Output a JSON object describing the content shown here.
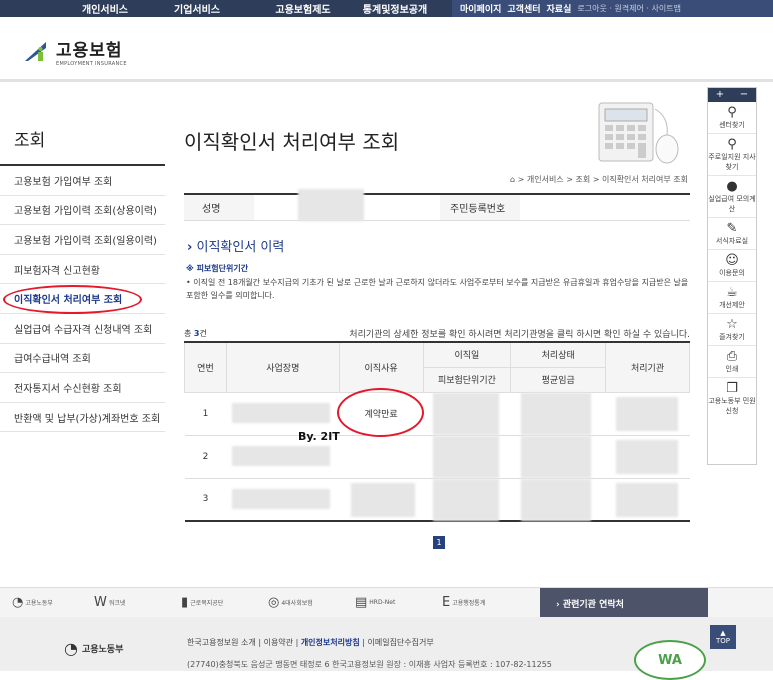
{
  "topnav": {
    "menu1": "개인서비스",
    "menu2": "기업서비스",
    "menu3": "고용보험제도",
    "menu4": "통계및정보공개",
    "mypage": "마이페이지",
    "center": "고객센터",
    "data": "자료실",
    "util": "로그아웃 · 원격제어 · 사이트맵"
  },
  "logo": {
    "name": "고용보험",
    "sub": "EMPLOYMENT INSURANCE"
  },
  "lnb": {
    "title": "조회",
    "items": [
      "고용보험 가입여부 조회",
      "고용보험 가입이력 조회(상용이력)",
      "고용보험 가입이력 조회(일용이력)",
      "피보험자격 신고현황",
      "이직확인서 처리여부 조회",
      "실업급여 수급자격 신청내역 조회",
      "급여수급내역 조회",
      "전자통지서 수신현황 조회",
      "반환액 및 납부(가상)계좌번호 조회"
    ]
  },
  "page": {
    "title": "이직확인서 처리여부 조회",
    "breadcrumb": "> 개인서비스 > 조회 > 이직확인서 처리여부 조회",
    "home_icon": "home-icon"
  },
  "info": {
    "name_label": "성명",
    "rrn_label": "주민등록번호"
  },
  "section": {
    "title": "이직확인서 이력",
    "note_head": "※ 피보험단위기간",
    "note": "• 이직일 전 18개월간 보수지급의 기초가 된 날로 근로한 날과 근로하지 않더라도 사업주로부터 보수를 지급받은 유급휴일과 휴업수당을 지급받은 날을 포함한 일수를 의미합니다."
  },
  "list": {
    "count_prefix": "총",
    "count": "3",
    "count_suffix": "건",
    "guide": "처리기관의 상세한 정보를 확인 하시려면 처리기관명을 클릭 하시면 확인 하실 수 있습니다.",
    "headers": {
      "no": "연번",
      "company": "사업장명",
      "reason": "이직사유",
      "date": "이직일",
      "unit": "피보험단위기간",
      "status": "처리상태",
      "wage": "평균임금",
      "agency": "처리기관"
    },
    "rows": [
      {
        "no": "1",
        "reason": "계약만료"
      },
      {
        "no": "2",
        "reason": ""
      },
      {
        "no": "3",
        "reason": ""
      }
    ]
  },
  "pager": {
    "current": "1"
  },
  "watermark": "By. 2IT",
  "quick": {
    "items": [
      "센터찾기",
      "주로일지원 지사찾기",
      "실업급여 모의계산",
      "서식자료실",
      "이용문의",
      "개선제안",
      "즐겨찾기",
      "인쇄",
      "고용노동부 민원신청"
    ]
  },
  "footer": {
    "banners": [
      "고용노동부",
      "워크넷",
      "근로복지공단",
      "4대사회보험",
      "HRD-Net",
      "고용행정통계"
    ],
    "related": "› 관련기관 연락처",
    "org": "고용노동부",
    "links_a": "한국고용정보원 소개",
    "links_b": "이용약관",
    "links_c": "개인정보처리방침",
    "links_d": "이메일집단수집거부",
    "address": "(27740)충청북도 음성군 맹동면 태정로 6 한국고용정보원   원장 : 이재흥   사업자 등록번호 : 107-82-11255",
    "top": "TOP",
    "wa": "WA"
  }
}
